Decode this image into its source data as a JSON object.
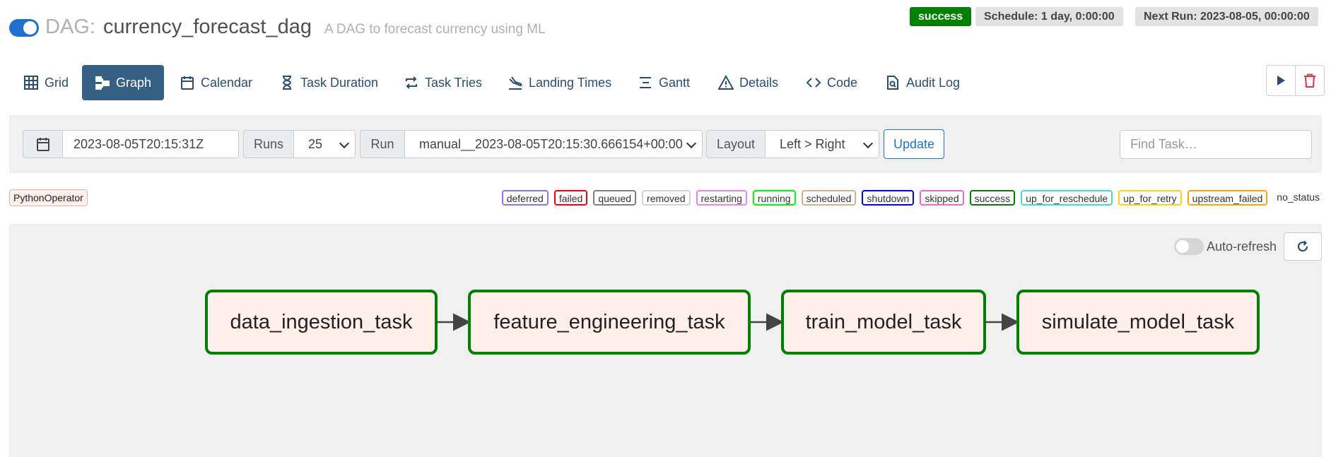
{
  "header": {
    "dag_prefix": "DAG:",
    "dag_id": "currency_forecast_dag",
    "description": "A DAG to forecast currency using ML",
    "status": "success",
    "schedule": "Schedule: 1 day, 0:00:00",
    "next_run": "Next Run: 2023-08-05, 00:00:00"
  },
  "tabs": [
    {
      "label": "Grid",
      "icon": "grid-icon",
      "active": false
    },
    {
      "label": "Graph",
      "icon": "graph-icon",
      "active": true
    },
    {
      "label": "Calendar",
      "icon": "calendar-icon",
      "active": false
    },
    {
      "label": "Task Duration",
      "icon": "hourglass-icon",
      "active": false
    },
    {
      "label": "Task Tries",
      "icon": "retry-icon",
      "active": false
    },
    {
      "label": "Landing Times",
      "icon": "plane-landing-icon",
      "active": false
    },
    {
      "label": "Gantt",
      "icon": "gantt-icon",
      "active": false
    },
    {
      "label": "Details",
      "icon": "warning-triangle-icon",
      "active": false
    },
    {
      "label": "Code",
      "icon": "code-icon",
      "active": false
    },
    {
      "label": "Audit Log",
      "icon": "document-search-icon",
      "active": false
    }
  ],
  "controls": {
    "date_value": "2023-08-05T20:15:31Z",
    "runs_label": "Runs",
    "runs_value": "25",
    "run_label": "Run",
    "run_value": "manual__2023-08-05T20:15:30.666154+00:00",
    "layout_label": "Layout",
    "layout_value": "Left > Right",
    "update_label": "Update",
    "find_placeholder": "Find Task…"
  },
  "legend": {
    "operator": "PythonOperator",
    "operator_color": "#ffefeb",
    "states": [
      {
        "label": "deferred",
        "color": "#9370db"
      },
      {
        "label": "failed",
        "color": "#ff0000"
      },
      {
        "label": "queued",
        "color": "#808080"
      },
      {
        "label": "removed",
        "color": "#d3d3d3"
      },
      {
        "label": "restarting",
        "color": "#ee82ee"
      },
      {
        "label": "running",
        "color": "#00ff00"
      },
      {
        "label": "scheduled",
        "color": "#d2b48c"
      },
      {
        "label": "shutdown",
        "color": "#0000ff"
      },
      {
        "label": "skipped",
        "color": "#ff69b4"
      },
      {
        "label": "success",
        "color": "#008000"
      },
      {
        "label": "up_for_reschedule",
        "color": "#40e0d0"
      },
      {
        "label": "up_for_retry",
        "color": "#ffd700"
      },
      {
        "label": "upstream_failed",
        "color": "#ffa500"
      },
      {
        "label": "no_status",
        "color": ""
      }
    ]
  },
  "graph": {
    "auto_refresh_label": "Auto-refresh",
    "auto_refresh_on": false,
    "nodes": [
      {
        "label": "data_ingestion_task",
        "state": "success"
      },
      {
        "label": "feature_engineering_task",
        "state": "success"
      },
      {
        "label": "train_model_task",
        "state": "success"
      },
      {
        "label": "simulate_model_task",
        "state": "success"
      }
    ]
  },
  "colors": {
    "success": "#008000",
    "active_tab": "#365f84",
    "link": "#2a4d73",
    "delete": "#dc3545"
  }
}
